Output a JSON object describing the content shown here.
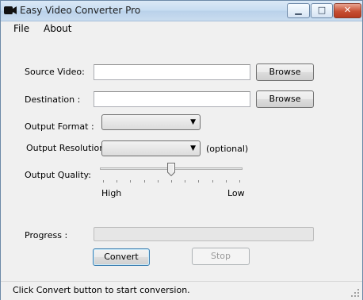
{
  "window": {
    "title": "Easy Video Converter Pro",
    "controls": {
      "minimize": "▁",
      "maximize": "□",
      "close": "✕"
    }
  },
  "menu": {
    "items": [
      "File",
      "About"
    ]
  },
  "form": {
    "source_label": "Source Video:",
    "source_value": "",
    "destination_label": "Destination :",
    "destination_value": "",
    "browse_label": "Browse",
    "format_label": "Output Format :",
    "format_value": "",
    "resolution_label": "Output Resolution :",
    "resolution_value": "",
    "resolution_hint": "(optional)",
    "quality_label": "Output Quality:",
    "quality_level": 0.5,
    "quality_high": "High",
    "quality_low": "Low",
    "progress_label": "Progress :",
    "progress_value": 0
  },
  "buttons": {
    "convert": "Convert",
    "stop": "Stop"
  },
  "status": {
    "text": "Click Convert button to start conversion."
  },
  "colors": {
    "window_bg": "#f0f0f0",
    "title_gradient": "#c7dcf1",
    "close_red": "#c74f33"
  }
}
